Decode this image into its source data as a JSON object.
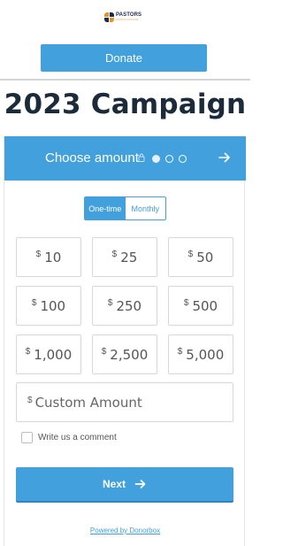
{
  "header": {
    "logo_text": "PASTORS",
    "logo_subtext": "ASSOCIATION",
    "donate_button": "Donate"
  },
  "campaign": {
    "title": "2023 Campaign"
  },
  "form": {
    "step_label": "Choose amount",
    "steps_total": 3,
    "current_step": 1,
    "frequency": {
      "options": [
        "One-time",
        "Monthly"
      ],
      "selected": "One-time"
    },
    "currency_symbol": "$",
    "amounts": [
      "10",
      "25",
      "50",
      "100",
      "250",
      "500",
      "1,000",
      "2,500",
      "5,000"
    ],
    "custom_placeholder": "Custom Amount",
    "comment_label": "Write us a comment",
    "next_button": "Next",
    "powered_by": "Powered by Donorbox"
  },
  "colors": {
    "accent": "#42a0dd",
    "title": "#1c2b3a",
    "logo_orange": "#e8912b",
    "logo_navy": "#1c2b4a"
  }
}
